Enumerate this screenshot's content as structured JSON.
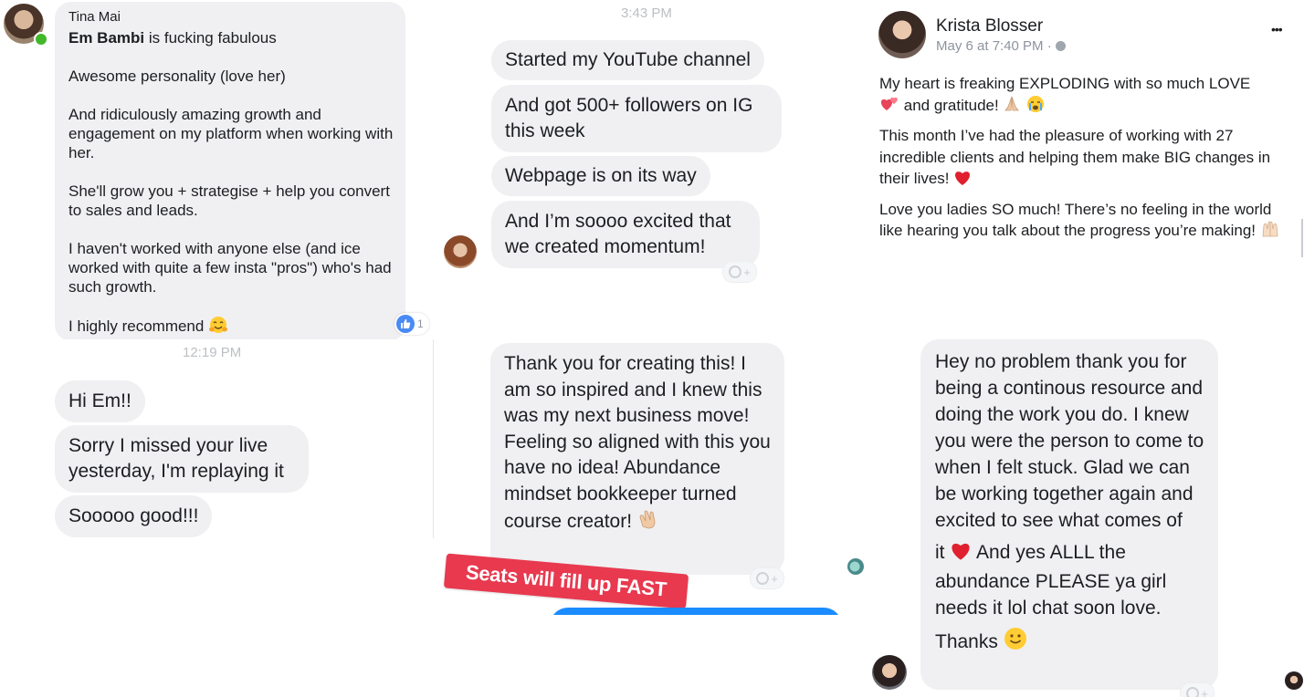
{
  "panel1": {
    "sender": "Tina Mai",
    "line1_bold": "Em Bambi",
    "line1_rest": " is fucking fabulous",
    "p2": "Awesome personality (love her)",
    "p3": "And ridiculously amazing growth and engagement on my platform when working with her.",
    "p4": "She'll grow you + strategise + help you convert to sales and leads.",
    "p5": "I haven't worked with anyone else (and ice worked with quite a few insta \"pros\") who's had such growth.",
    "p6": "I highly recommend",
    "like_count": "1"
  },
  "panel2": {
    "time": "3:43 PM",
    "messages": [
      "Started my YouTube channel",
      "And got 500+ followers on IG this week",
      "Webpage is on its way",
      "And I’m soooo excited that we created momentum!"
    ]
  },
  "panel3": {
    "author": "Krista Blosser",
    "meta": "May 6 at 7:40 PM ·",
    "more": "•••",
    "p1a": "My heart is freaking EXPLODING with so much LOVE",
    "p1b": "and gratitude!",
    "p2": "This month I’ve had the pleasure of working with 27 incredible clients and helping them make BIG changes in their lives!",
    "p3": "Love you ladies SO much! There’s no feeling in the world like hearing you talk about the progress you’re making!"
  },
  "panel4": {
    "time": "12:19 PM",
    "messages": [
      "Hi Em!!",
      "Sorry I missed your live yesterday, I'm replaying it",
      "Sooooo good!!!"
    ]
  },
  "panel5": {
    "message": "Thank you for creating this! I am so inspired and I knew this was my next business move! Feeling so aligned with this you have no idea! Abundance mindset bookkeeper turned course creator!",
    "sticker": "Seats will fill up FAST"
  },
  "panel6": {
    "message_a": "Hey no problem thank you for being a continous resource and doing the work you do. I knew you were the person to come to when I felt stuck. Glad we can be working together again and excited to see what comes of",
    "message_b": "it",
    "message_c": "And yes ALLL the abundance PLEASE ya girl needs it lol chat soon love.",
    "message_d": "Thanks"
  },
  "colors": {
    "bubble": "#f0f0f2",
    "like_blue": "#4a8af4",
    "sticker_red": "#e8394f",
    "messenger_blue": "#1a8cff",
    "online_green": "#42b72a"
  },
  "icons": [
    "avatar",
    "online-dot-icon",
    "like-icon",
    "add-reaction-icon",
    "heart-icon",
    "more-icon",
    "globe-icon",
    "smile-icon",
    "clap-icon",
    "raised-hands-icon",
    "praying-hands-icon",
    "two-hearts-icon",
    "hug-face-icon",
    "crying-face-icon"
  ]
}
